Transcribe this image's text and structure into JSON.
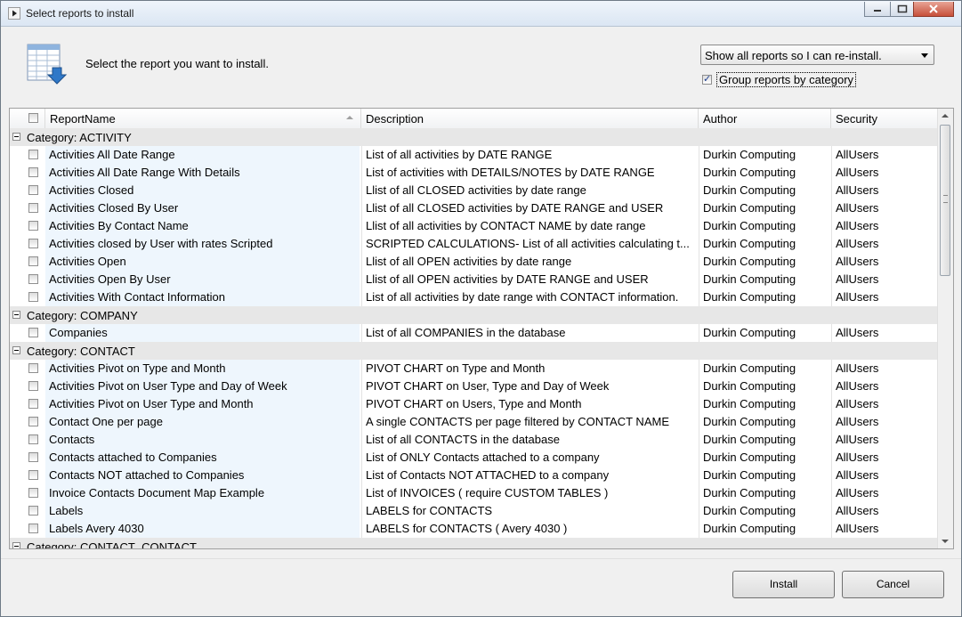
{
  "window": {
    "title": "Select reports to install"
  },
  "header": {
    "text": "Select the report you want to install.",
    "filter_combo": {
      "value": "Show all reports so I can re-install."
    },
    "group_checkbox": {
      "label": "Group reports by category",
      "checked": true
    }
  },
  "grid": {
    "columns": {
      "name": "ReportName",
      "description": "Description",
      "author": "Author",
      "security": "Security"
    },
    "categories": [
      {
        "label": "Category:  ACTIVITY",
        "rows": [
          {
            "name": "Activities  All  Date Range",
            "description": "List of all activities by DATE RANGE",
            "author": "Durkin Computing",
            "security": "AllUsers"
          },
          {
            "name": "Activities  All  Date Range With Details",
            "description": "List of activities with DETAILS/NOTES by DATE RANGE",
            "author": "Durkin Computing",
            "security": "AllUsers"
          },
          {
            "name": "Activities  Closed",
            "description": "Llist of all CLOSED activities by date range",
            "author": "Durkin Computing",
            "security": "AllUsers"
          },
          {
            "name": "Activities  Closed By User",
            "description": "Llist of all CLOSED activities by DATE RANGE and USER",
            "author": "Durkin Computing",
            "security": "AllUsers"
          },
          {
            "name": "Activities By Contact Name",
            "description": "Llist of all activities by CONTACT NAME by date range",
            "author": "Durkin Computing",
            "security": "AllUsers"
          },
          {
            "name": "Activities closed by User with rates Scripted",
            "description": "SCRIPTED CALCULATIONS- List of all activities calculating t...",
            "author": "Durkin Computing",
            "security": "AllUsers"
          },
          {
            "name": "Activities Open",
            "description": "Llist of all OPEN activities by date range",
            "author": "Durkin Computing",
            "security": "AllUsers"
          },
          {
            "name": "Activities Open By User",
            "description": "Llist of all OPEN activities by DATE RANGE and USER",
            "author": "Durkin Computing",
            "security": "AllUsers"
          },
          {
            "name": "Activities With Contact Information",
            "description": "List of all activities by date range with CONTACT information.",
            "author": "Durkin Computing",
            "security": "AllUsers"
          }
        ]
      },
      {
        "label": "Category:  COMPANY",
        "rows": [
          {
            "name": "Companies",
            "description": "List of all COMPANIES in the database",
            "author": "Durkin Computing",
            "security": "AllUsers"
          }
        ]
      },
      {
        "label": "Category:  CONTACT",
        "rows": [
          {
            "name": "Activities Pivot on Type and Month",
            "description": "PIVOT CHART on Type and Month",
            "author": "Durkin Computing",
            "security": "AllUsers"
          },
          {
            "name": "Activities Pivot on User Type and Day of Week",
            "description": "PIVOT CHART on User, Type and Day of Week",
            "author": "Durkin Computing",
            "security": "AllUsers"
          },
          {
            "name": "Activities Pivot on User Type and Month",
            "description": "PIVOT CHART on Users, Type and Month",
            "author": "Durkin Computing",
            "security": "AllUsers"
          },
          {
            "name": "Contact One per page",
            "description": "A single CONTACTS per page filtered by CONTACT NAME",
            "author": "Durkin Computing",
            "security": "AllUsers"
          },
          {
            "name": "Contacts",
            "description": "List of all CONTACTS in the database",
            "author": "Durkin Computing",
            "security": "AllUsers"
          },
          {
            "name": "Contacts attached to Companies",
            "description": "List of ONLY Contacts attached to a company",
            "author": "Durkin Computing",
            "security": "AllUsers"
          },
          {
            "name": "Contacts NOT attached to Companies",
            "description": "List of Contacts NOT ATTACHED to a company",
            "author": "Durkin Computing",
            "security": "AllUsers"
          },
          {
            "name": "Invoice Contacts Document Map Example",
            "description": "List of INVOICES ( require CUSTOM TABLES )",
            "author": "Durkin Computing",
            "security": "AllUsers"
          },
          {
            "name": "Labels",
            "description": "LABELS for CONTACTS",
            "author": "Durkin Computing",
            "security": "AllUsers"
          },
          {
            "name": "Labels Avery 4030",
            "description": "LABELS for CONTACTS ( Avery 4030 )",
            "author": "Durkin Computing",
            "security": "AllUsers"
          }
        ]
      },
      {
        "label": "Category:  CONTACT_CONTACT",
        "rows": []
      }
    ]
  },
  "buttons": {
    "install": "Install",
    "cancel": "Cancel"
  },
  "icons": {
    "title": "play-icon",
    "header": "report-download-icon"
  }
}
